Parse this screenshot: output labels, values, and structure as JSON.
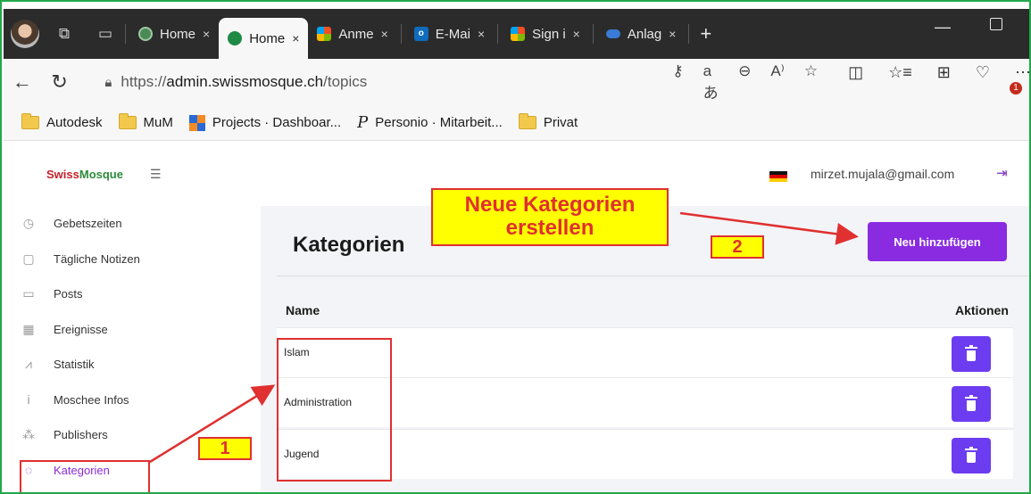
{
  "browser": {
    "tabs": [
      {
        "label": "Home",
        "icon": "globe-favicon"
      },
      {
        "label": "Home",
        "icon": "swissmosque-favicon",
        "active": true
      },
      {
        "label": "Anme",
        "icon": "microsoft-favicon"
      },
      {
        "label": "E-Mai",
        "icon": "outlook-favicon"
      },
      {
        "label": "Sign i",
        "icon": "microsoft-favicon"
      },
      {
        "label": "Anlag",
        "icon": "cloud-favicon"
      }
    ],
    "close_glyph": "×",
    "url_prefix": "https://",
    "url_host": "admin.swissmosque.ch",
    "url_path": "/topics",
    "notification_count": "1"
  },
  "bookmarks": [
    {
      "label": "Autodesk",
      "icon": "folder-icon"
    },
    {
      "label": "MuM",
      "icon": "folder-icon"
    },
    {
      "label": "Projects · Dashboar...",
      "icon": "projects-icon"
    },
    {
      "label": "Personio · Mitarbeit...",
      "icon": "personio-icon"
    },
    {
      "label": "Privat",
      "icon": "folder-icon"
    }
  ],
  "app": {
    "brand_part1": "Swiss",
    "brand_part2": "Mosque",
    "user_email": "mirzet.mujala@gmail.com"
  },
  "sidebar": {
    "items": [
      {
        "label": "Gebetszeiten",
        "icon": "clock-icon"
      },
      {
        "label": "Tägliche Notizen",
        "icon": "note-icon"
      },
      {
        "label": "Posts",
        "icon": "chat-icon"
      },
      {
        "label": "Ereignisse",
        "icon": "calendar-icon"
      },
      {
        "label": "Statistik",
        "icon": "chart-icon"
      },
      {
        "label": "Moschee Infos",
        "icon": "info-icon"
      },
      {
        "label": "Publishers",
        "icon": "users-icon"
      },
      {
        "label": "Kategorien",
        "icon": "speech-bubble-icon",
        "active": true
      }
    ]
  },
  "main": {
    "title": "Kategorien",
    "add_button": "Neu hinzufügen",
    "col_name": "Name",
    "col_actions": "Aktionen",
    "rows": [
      {
        "name": "Islam"
      },
      {
        "name": "Administration"
      },
      {
        "name": "Jugend"
      }
    ]
  },
  "annotations": {
    "callout_line1": "Neue Kategorien",
    "callout_line2": "erstellen",
    "step1": "1",
    "step2": "2",
    "color": "#e03030",
    "highlight": "#ffff00"
  }
}
